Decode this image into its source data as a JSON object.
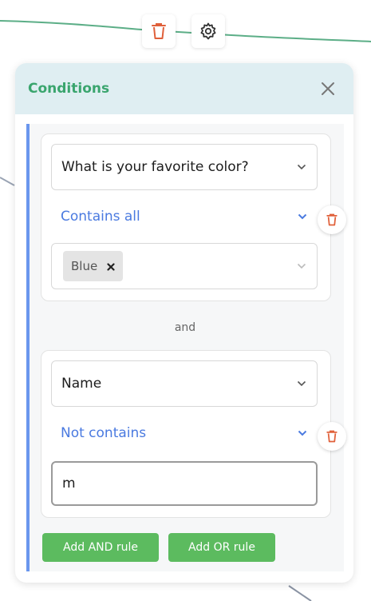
{
  "toolbar": {
    "delete_icon": "trash-icon",
    "settings_icon": "gear-icon"
  },
  "panel": {
    "title": "Conditions",
    "close_icon": "close-icon"
  },
  "rules": [
    {
      "question": "What is your favorite color?",
      "operator": "Contains all",
      "values": [
        "Blue"
      ],
      "remove_icon": "x-icon"
    },
    {
      "question": "Name",
      "operator": "Not contains",
      "value": "m"
    }
  ],
  "joiner": "and",
  "buttons": {
    "add_and": "Add AND rule",
    "add_or": "Add OR rule"
  },
  "colors": {
    "accent_green": "#3aa56e",
    "button_green": "#5cbb5f",
    "link_blue": "#4a7ae0",
    "bar_blue": "#6a96ee",
    "delete_red": "#e0603a"
  }
}
